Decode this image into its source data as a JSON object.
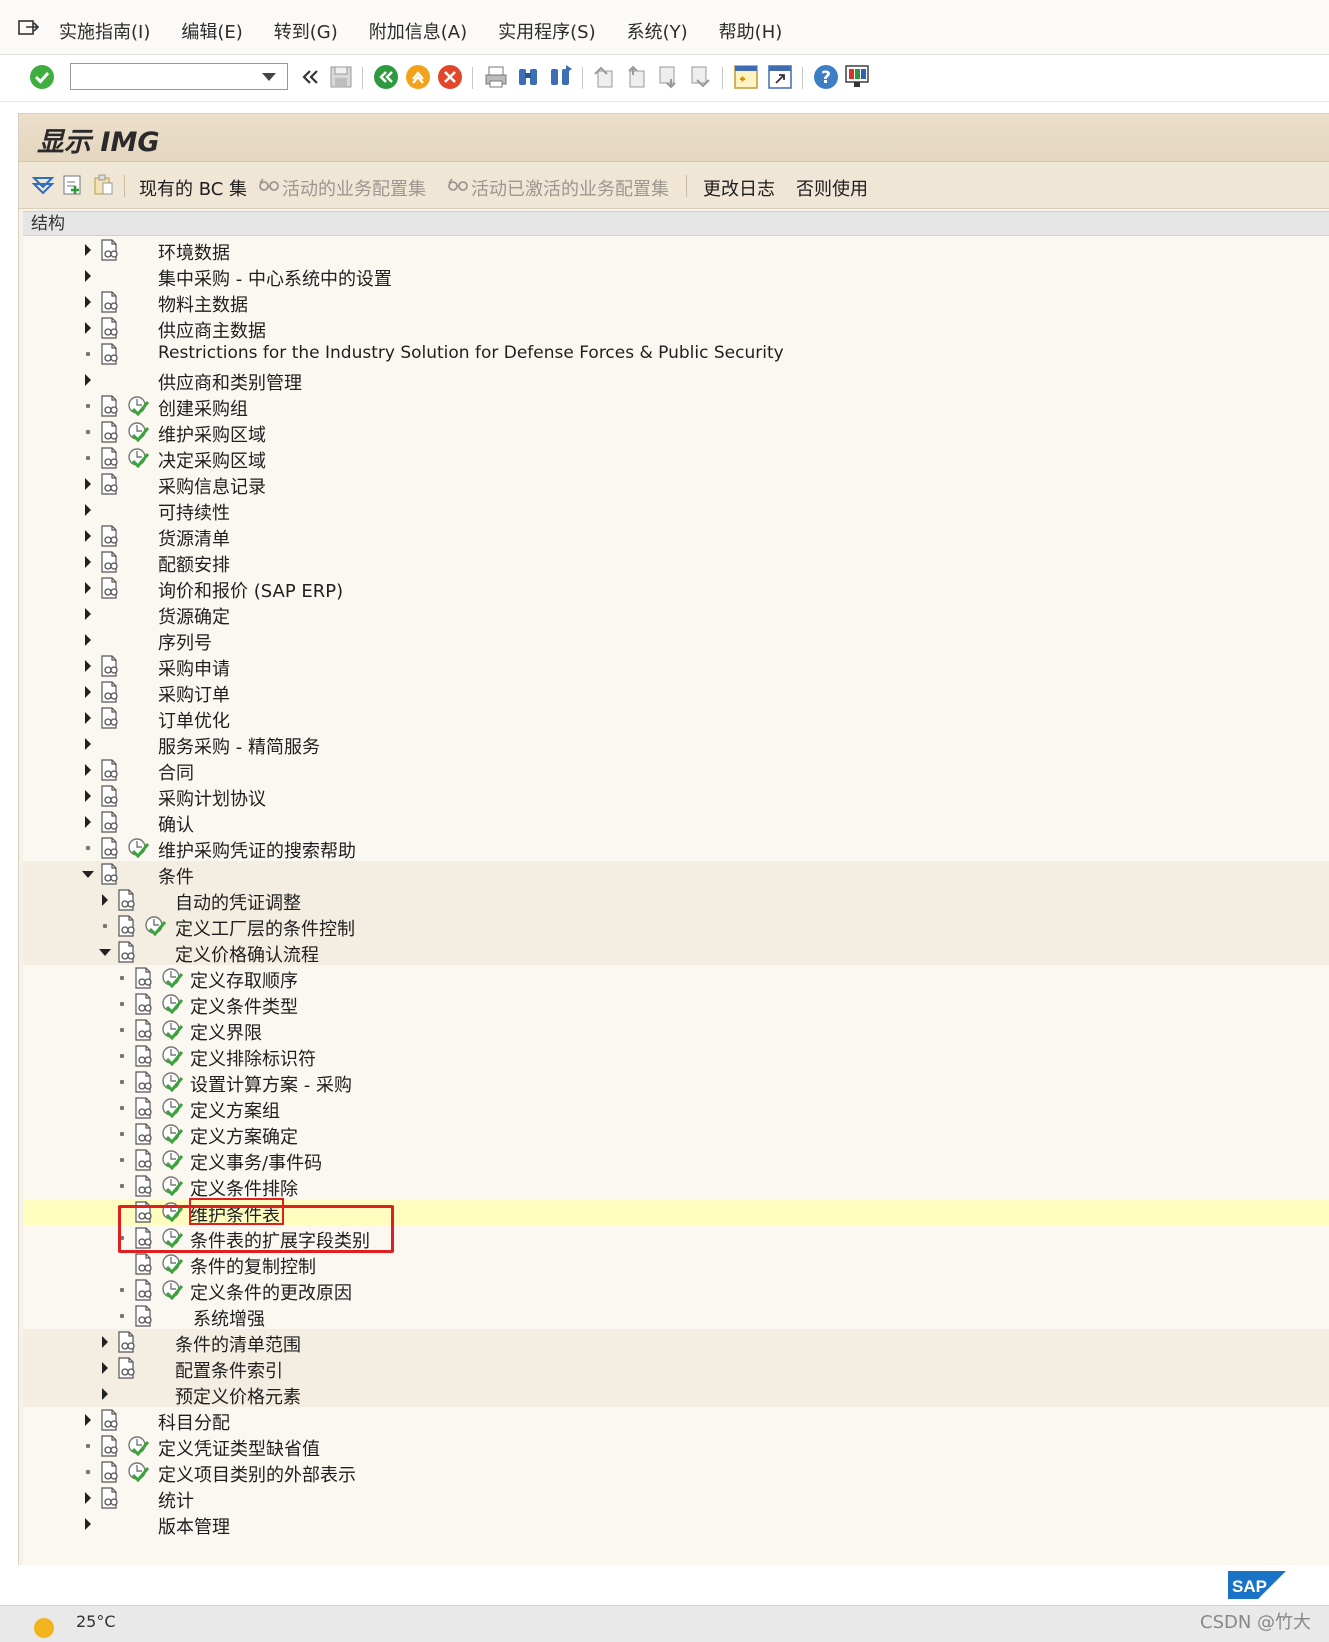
{
  "menu": {
    "items": [
      "实施指南(I)",
      "编辑(E)",
      "转到(G)",
      "附加信息(A)",
      "实用程序(S)",
      "系统(Y)",
      "帮助(H)"
    ]
  },
  "toolbar": {
    "command_field_value": "",
    "icons": [
      "enter-check-icon",
      "back-icon",
      "save-icon",
      "back-green-icon",
      "exit-icon",
      "cancel-icon",
      "print-icon",
      "find-icon",
      "find-next-icon",
      "first-page-icon",
      "previous-page-icon",
      "next-page-icon",
      "last-page-icon",
      "create-session-icon",
      "shortcut-icon",
      "help-icon",
      "layout-icon"
    ]
  },
  "header": {
    "title": "显示 IMG"
  },
  "app_toolbar": {
    "current_bc_set": "现有的 BC 集",
    "active_bc_set": "活动的业务配置集",
    "activated_bc_set": "活动已激活的业务配置集",
    "change_log": "更改日志",
    "otherwise_use": "否则使用"
  },
  "tree": {
    "column_header": "结构",
    "nodes": [
      {
        "label": "环境数据",
        "level": 0,
        "state": "collapsed",
        "doc": true,
        "exec": false
      },
      {
        "label": "集中采购 - 中心系统中的设置",
        "level": 0,
        "state": "collapsed",
        "doc": false,
        "exec": false
      },
      {
        "label": "物料主数据",
        "level": 0,
        "state": "collapsed",
        "doc": true,
        "exec": false
      },
      {
        "label": "供应商主数据",
        "level": 0,
        "state": "collapsed",
        "doc": true,
        "exec": false
      },
      {
        "label": "Restrictions for the Industry Solution for Defense Forces & Public Security",
        "level": 0,
        "state": "leaf",
        "doc": true,
        "exec": false,
        "latin": true
      },
      {
        "label": "供应商和类别管理",
        "level": 0,
        "state": "collapsed",
        "doc": false,
        "exec": false
      },
      {
        "label": "创建采购组",
        "level": 0,
        "state": "leaf",
        "doc": true,
        "exec": true
      },
      {
        "label": "维护采购区域",
        "level": 0,
        "state": "leaf",
        "doc": true,
        "exec": true
      },
      {
        "label": "决定采购区域",
        "level": 0,
        "state": "leaf",
        "doc": true,
        "exec": true
      },
      {
        "label": "采购信息记录",
        "level": 0,
        "state": "collapsed",
        "doc": true,
        "exec": false
      },
      {
        "label": "可持续性",
        "level": 0,
        "state": "collapsed",
        "doc": false,
        "exec": false
      },
      {
        "label": "货源清单",
        "level": 0,
        "state": "collapsed",
        "doc": true,
        "exec": false
      },
      {
        "label": "配额安排",
        "level": 0,
        "state": "collapsed",
        "doc": true,
        "exec": false
      },
      {
        "label": "询价和报价 (SAP ERP)",
        "level": 0,
        "state": "collapsed",
        "doc": true,
        "exec": false
      },
      {
        "label": "货源确定",
        "level": 0,
        "state": "collapsed",
        "doc": false,
        "exec": false
      },
      {
        "label": "序列号",
        "level": 0,
        "state": "collapsed",
        "doc": false,
        "exec": false
      },
      {
        "label": "采购申请",
        "level": 0,
        "state": "collapsed",
        "doc": true,
        "exec": false
      },
      {
        "label": "采购订单",
        "level": 0,
        "state": "collapsed",
        "doc": true,
        "exec": false
      },
      {
        "label": "订单优化",
        "level": 0,
        "state": "collapsed",
        "doc": true,
        "exec": false
      },
      {
        "label": "服务采购 - 精简服务",
        "level": 0,
        "state": "collapsed",
        "doc": false,
        "exec": false
      },
      {
        "label": "合同",
        "level": 0,
        "state": "collapsed",
        "doc": true,
        "exec": false
      },
      {
        "label": "采购计划协议",
        "level": 0,
        "state": "collapsed",
        "doc": true,
        "exec": false
      },
      {
        "label": "确认",
        "level": 0,
        "state": "collapsed",
        "doc": true,
        "exec": false
      },
      {
        "label": "维护采购凭证的搜索帮助",
        "level": 0,
        "state": "leaf",
        "doc": true,
        "exec": true
      },
      {
        "label": "条件",
        "level": 0,
        "state": "expanded",
        "doc": true,
        "exec": false
      },
      {
        "label": "自动的凭证调整",
        "level": 1,
        "state": "collapsed",
        "doc": true,
        "exec": false
      },
      {
        "label": "定义工厂层的条件控制",
        "level": 1,
        "state": "leaf",
        "doc": true,
        "exec": true
      },
      {
        "label": "定义价格确认流程",
        "level": 1,
        "state": "expanded",
        "doc": true,
        "exec": false
      },
      {
        "label": "定义存取顺序",
        "level": 2,
        "state": "leaf",
        "doc": true,
        "exec": true
      },
      {
        "label": "定义条件类型",
        "level": 2,
        "state": "leaf",
        "doc": true,
        "exec": true
      },
      {
        "label": "定义界限",
        "level": 2,
        "state": "leaf",
        "doc": true,
        "exec": true
      },
      {
        "label": "定义排除标识符",
        "level": 2,
        "state": "leaf",
        "doc": true,
        "exec": true
      },
      {
        "label": "设置计算方案 - 采购",
        "level": 2,
        "state": "leaf",
        "doc": true,
        "exec": true
      },
      {
        "label": "定义方案组",
        "level": 2,
        "state": "leaf",
        "doc": true,
        "exec": true
      },
      {
        "label": "定义方案确定",
        "level": 2,
        "state": "leaf",
        "doc": true,
        "exec": true
      },
      {
        "label": "定义事务/事件码",
        "level": 2,
        "state": "leaf",
        "doc": true,
        "exec": true
      },
      {
        "label": "定义条件排除",
        "level": 2,
        "state": "leaf",
        "doc": true,
        "exec": true
      },
      {
        "label": "维护条件表",
        "level": 2,
        "state": "none",
        "doc": true,
        "exec": true,
        "highlight": true
      },
      {
        "label": "条件表的扩展字段类别",
        "level": 2,
        "state": "leaf",
        "doc": true,
        "exec": true
      },
      {
        "label": "条件的复制控制",
        "level": 2,
        "state": "none",
        "doc": true,
        "exec": true
      },
      {
        "label": "定义条件的更改原因",
        "level": 2,
        "state": "leaf",
        "doc": true,
        "exec": true
      },
      {
        "label": "系统增强",
        "level": 2,
        "state": "leaf",
        "doc": true,
        "exec": false
      },
      {
        "label": "条件的清单范围",
        "level": 1,
        "state": "collapsed",
        "doc": true,
        "exec": false
      },
      {
        "label": "配置条件索引",
        "level": 1,
        "state": "collapsed",
        "doc": true,
        "exec": false
      },
      {
        "label": "预定义价格元素",
        "level": 1,
        "state": "collapsed",
        "doc": false,
        "exec": false
      },
      {
        "label": "科目分配",
        "level": 0,
        "state": "collapsed",
        "doc": true,
        "exec": false
      },
      {
        "label": "定义凭证类型缺省值",
        "level": 0,
        "state": "leaf",
        "doc": true,
        "exec": true
      },
      {
        "label": "定义项目类别的外部表示",
        "level": 0,
        "state": "leaf",
        "doc": true,
        "exec": true
      },
      {
        "label": "统计",
        "level": 0,
        "state": "collapsed",
        "doc": true,
        "exec": false
      },
      {
        "label": "版本管理",
        "level": 0,
        "state": "collapsed",
        "doc": false,
        "exec": false
      }
    ]
  },
  "taskbar": {
    "temperature": "25°C"
  },
  "watermark": "CSDN @竹大",
  "colors": {
    "panel_bg": "#f7f2e8",
    "highlight_row": "#fffcc0",
    "annotation_red": "#e02020",
    "exec_green": "#3aa33a"
  }
}
